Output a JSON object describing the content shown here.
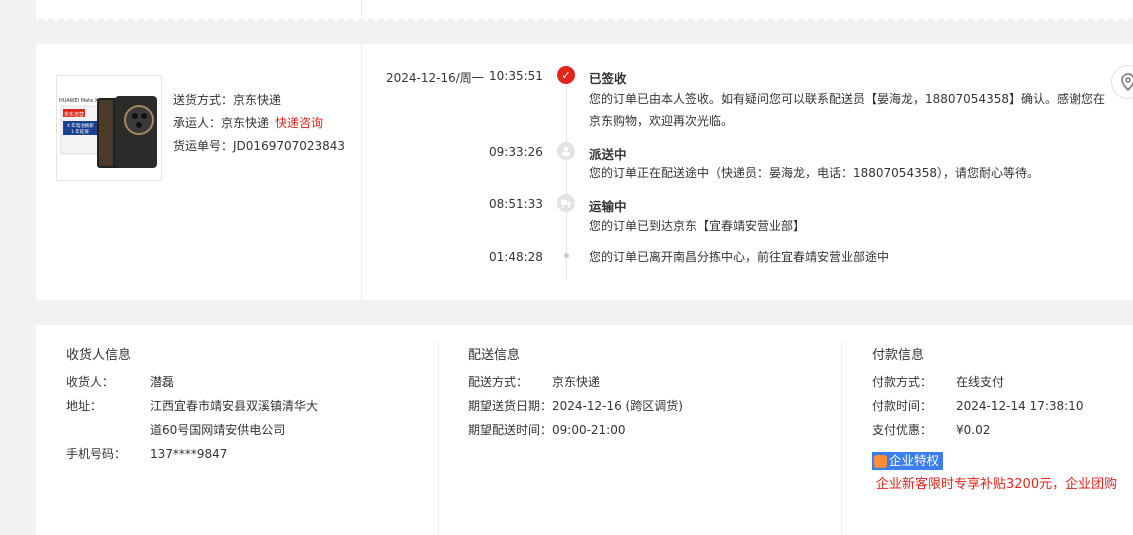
{
  "shipment": {
    "product_image_alt": "HUAWEI Mate X6",
    "product_image_text": {
      "brand": "HUAWEI Mate X6",
      "badge": "京东自营",
      "line1": "4 年电池换新",
      "line2": "1 年延保"
    },
    "method_label": "送货方式：",
    "method_value": "京东快递",
    "carrier_label": "承运人：",
    "carrier_value": "京东快递",
    "carrier_link": "快递咨询",
    "tracking_label": "货运单号：",
    "tracking_value": "JD0169707023843"
  },
  "timeline": {
    "date": "2024-12-16/周一",
    "events": [
      {
        "time": "10:35:51",
        "status": "已签收",
        "icon": "check-icon",
        "desc": "您的订单已由本人签收。如有疑问您可以联系配送员【晏海龙，18807054358】确认。感谢您在京东购物，欢迎再次光临。"
      },
      {
        "time": "09:33:26",
        "status": "派送中",
        "icon": "courier-icon",
        "desc": "您的订单正在配送途中（快递员：晏海龙，电话：18807054358），请您耐心等待。"
      },
      {
        "time": "08:51:33",
        "status": "运输中",
        "icon": "truck-icon",
        "desc": "您的订单已到达京东【宜春靖安营业部】"
      },
      {
        "time": "01:48:28",
        "status": "",
        "icon": "dot",
        "desc": "您的订单已离开南昌分拣中心，前往宜春靖安营业部途中"
      }
    ]
  },
  "recipient": {
    "title": "收货人信息",
    "name_label": "收货人：",
    "name_value": "潜磊",
    "address_label": "地址：",
    "address_line1": "江西宜春市靖安县双溪镇清华大",
    "address_line2": "道60号国网靖安供电公司",
    "phone_label": "手机号码：",
    "phone_value": "137****9847"
  },
  "delivery": {
    "title": "配送信息",
    "method_label": "配送方式：",
    "method_value": "京东快递",
    "date_label": "期望送货日期：",
    "date_value": "2024-12-16 (跨区调货)",
    "time_label": "期望配送时间：",
    "time_value": "09:00-21:00"
  },
  "payment": {
    "title": "付款信息",
    "method_label": "付款方式：",
    "method_value": "在线支付",
    "time_label": "付款时间：",
    "time_value": "2024-12-14 17:38:10",
    "discount_label": "支付优惠：",
    "discount_value": "¥0.02",
    "badge": "企业特权",
    "promo": "企业新客限时专享补贴3200元，企业团购"
  },
  "colors": {
    "accent": "#e1251b",
    "badge_blue": "#3b7ef0"
  }
}
